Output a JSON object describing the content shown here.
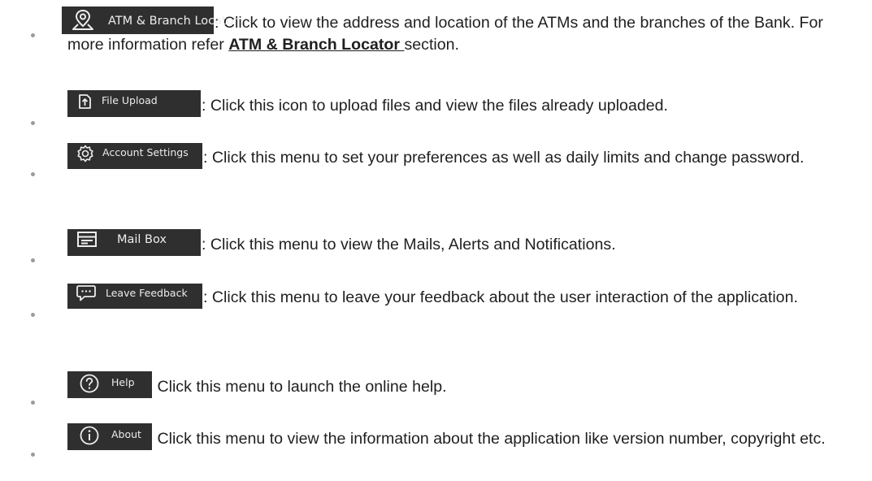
{
  "items": [
    {
      "menu_label": "ATM & Branch Locator",
      "icon": "location-pin-icon",
      "text_before": ": Click to view the address and location of the ATMs and the branches of the Bank. For more information refer ",
      "link_text": "ATM & Branch Locator ",
      "text_after": "section."
    },
    {
      "menu_label": "File Upload",
      "icon": "file-upload-icon",
      "text": ": Click this icon to upload files and view the files already uploaded."
    },
    {
      "menu_label": "Account Settings",
      "icon": "gear-icon",
      "text": ": Click this menu to set your preferences as well as daily limits and change password."
    },
    {
      "menu_label": "Mail Box",
      "icon": "mail-box-icon",
      "text": ": Click this menu to view the Mails, Alerts and Notifications."
    },
    {
      "menu_label": "Leave Feedback",
      "icon": "chat-bubble-icon",
      "text": ": Click this menu to leave your feedback about the user interaction of the application."
    },
    {
      "menu_label": "Help",
      "icon": "help-question-icon",
      "text": " Click this menu to launch the online help."
    },
    {
      "menu_label": "About",
      "icon": "info-icon",
      "text": " Click this menu to view the information about the application like version number, copyright etc."
    }
  ],
  "colors": {
    "menu_background": "#2f2f2f",
    "menu_text": "#ececec",
    "body_text": "#1f1f1f",
    "bullet": "#9b9b9b"
  }
}
